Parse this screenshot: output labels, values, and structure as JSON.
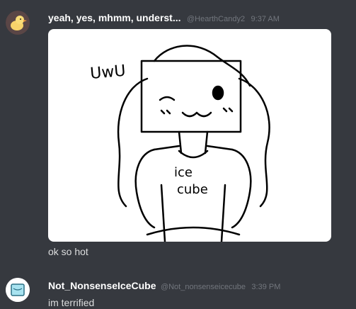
{
  "messages": [
    {
      "username": "yeah, yes, mhmm, underst...",
      "handle": "@HearthCandy2",
      "time": "9:37 AM",
      "image_texts": [
        "UwU",
        "ice",
        "cube"
      ],
      "text": "ok so hot"
    },
    {
      "username": "Not_NonsenseIceCube",
      "handle": "@Not_nonsenseicecube",
      "time": "3:39 PM",
      "text": "im terrified"
    }
  ],
  "icons": {
    "avatar_1": "duck-avatar-icon",
    "avatar_2": "ice-cube-avatar-icon"
  },
  "colors": {
    "background": "#36393f",
    "username": "#ffffff",
    "meta": "#72767d",
    "text": "#dcddde"
  }
}
